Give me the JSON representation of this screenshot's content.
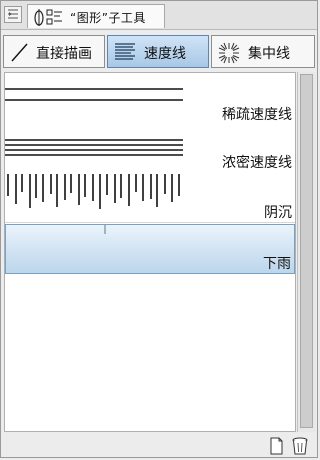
{
  "palette": {
    "title": "“图形”子工具"
  },
  "tabs": [
    {
      "label": "直接描画",
      "icon": "straight-line-icon",
      "active": false
    },
    {
      "label": "速度线",
      "icon": "speed-lines-icon",
      "active": true
    },
    {
      "label": "集中线",
      "icon": "focus-lines-icon",
      "active": false
    }
  ],
  "presets": [
    {
      "name": "稀疏速度线",
      "selected": false
    },
    {
      "name": "浓密速度线",
      "selected": false
    },
    {
      "name": "阴沉",
      "selected": false
    },
    {
      "name": "下雨",
      "selected": true
    }
  ],
  "footer": {
    "new_icon": "new-preset-icon",
    "delete_icon": "trash-icon"
  }
}
